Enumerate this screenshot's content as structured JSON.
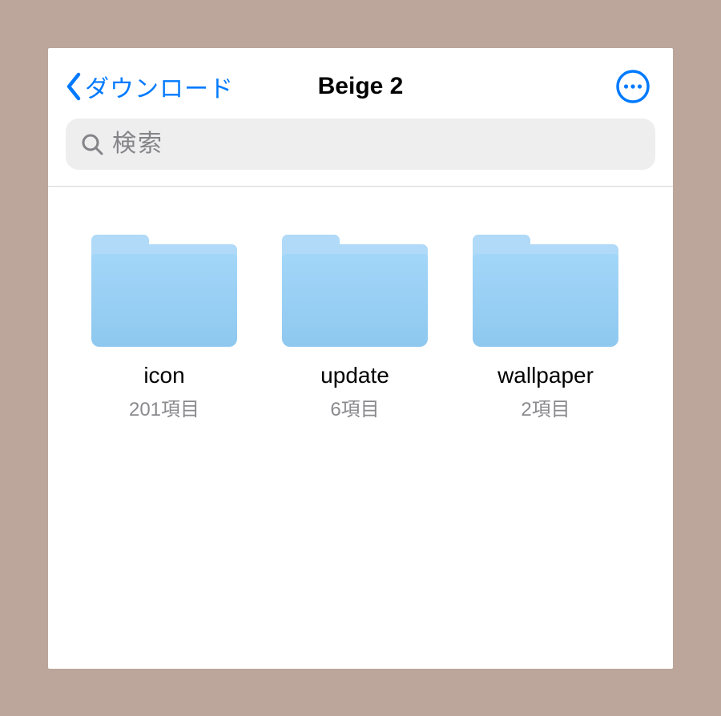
{
  "nav": {
    "back_label": "ダウンロード",
    "title": "Beige 2"
  },
  "search": {
    "placeholder": "検索"
  },
  "folders": [
    {
      "name": "icon",
      "meta": "201項目"
    },
    {
      "name": "update",
      "meta": "6項目"
    },
    {
      "name": "wallpaper",
      "meta": "2項目"
    }
  ]
}
